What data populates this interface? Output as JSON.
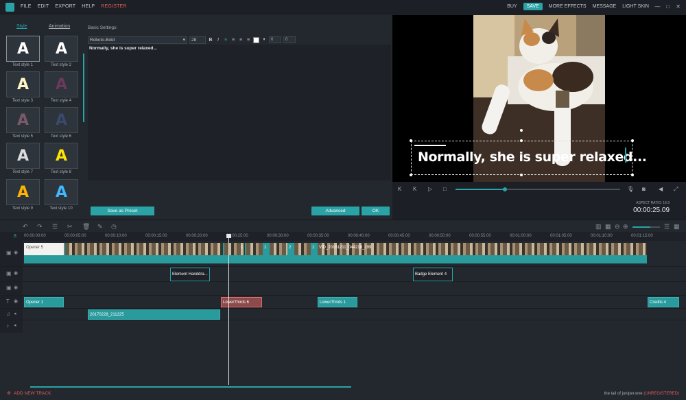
{
  "menu": {
    "items": [
      "FILE",
      "EDIT",
      "EXPORT",
      "HELP"
    ],
    "register": "REGISTER",
    "right": {
      "buy": "BUY",
      "save": "SAVE",
      "more_effects": "MORE EFFECTS",
      "message": "MESSAGE",
      "light_skin": "LIGHT SKIN"
    },
    "window": {
      "minimize": "—",
      "restore": "□",
      "close": "✕"
    }
  },
  "style_panel": {
    "tabs": {
      "style": "Style",
      "animation": "Animation"
    },
    "styles": [
      {
        "label": "Text style 1",
        "glyph": "A",
        "color": "#ffffff"
      },
      {
        "label": "Text style 2",
        "glyph": "A",
        "color": "#ffffff"
      },
      {
        "label": "Text style 3",
        "glyph": "A",
        "color": "#fff6c8"
      },
      {
        "label": "Text style 4",
        "glyph": "A",
        "color": "#6a3a5a"
      },
      {
        "label": "Text style 5",
        "glyph": "A",
        "color": "#7a5a6a"
      },
      {
        "label": "Text style 6",
        "glyph": "A",
        "color": "#3a4a6a"
      },
      {
        "label": "Text style 7",
        "glyph": "A",
        "color": "#dddddd"
      },
      {
        "label": "Text style 8",
        "glyph": "A",
        "color": "#ffe300"
      },
      {
        "label": "Text style 9",
        "glyph": "A",
        "color": "#ffb300"
      },
      {
        "label": "Text style 10",
        "glyph": "A",
        "color": "#3fb8ff"
      }
    ]
  },
  "settings": {
    "heading": "Basic Settings:",
    "font": "Roboto-Bold",
    "size": "28",
    "bold": "B",
    "italic": "I",
    "spin1": "0",
    "spin2": "0",
    "text": "Normally, she is super relaxed...",
    "save_preset": "Save as Preset",
    "advanced": "Advanced",
    "ok": "OK"
  },
  "preview": {
    "caption": "Normally, she is super relaxed...",
    "aspect_ratio": "ASPECT RATIO: 16:9",
    "timecode": "00:00:25.09",
    "progress": 0.3
  },
  "ruler": {
    "ticks": [
      "00:00:00:00",
      "00:00:05:00",
      "00:00:10:00",
      "00:00:15:00",
      "00:00:20:00",
      "00:00:25:00",
      "00:00:30:00",
      "00:00:35:00",
      "00:00:40:00",
      "00:00:45:00",
      "00:00:50:00",
      "00:00:55:00",
      "00:01:00:00",
      "00:01:05:00",
      "00:01:10:00",
      "00:01:15:00"
    ],
    "marker": "8"
  },
  "timeline": {
    "video_clips": {
      "opener": "Opener 5",
      "number_labels": [
        "1",
        "1",
        "2",
        "1"
      ],
      "long_label": "VID_20161211_044218_199"
    },
    "elements": [
      "Element Handdra...",
      "Badge Element 4"
    ],
    "text_clips": [
      "Opener 1",
      "LowerThirds 6",
      "LowerThirds 1",
      "Credits 4"
    ],
    "audio_clips": [
      "20170228_211225"
    ]
  },
  "bottom": {
    "add_track": "ADD NEW TRACK",
    "project": "the tail of juniper.wve",
    "unregistered": "(UNREGISTERED)"
  },
  "colors": {
    "accent": "#2aa3a7",
    "bg": "#23282f",
    "register_red": "#e05a5a"
  }
}
